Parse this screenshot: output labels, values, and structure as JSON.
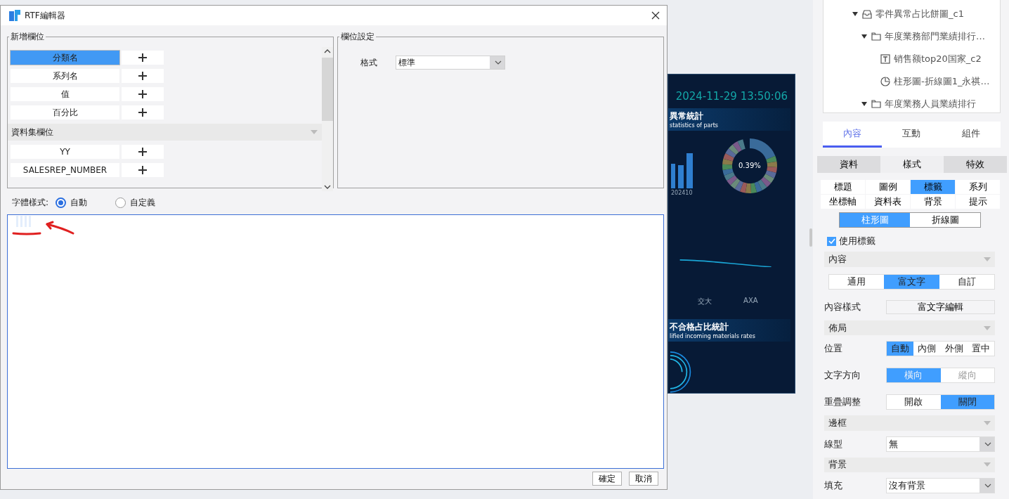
{
  "dialog": {
    "title": "RTF編輯器",
    "add_fields": {
      "legend": "新增欄位",
      "items": [
        {
          "label": "分類名",
          "selected": true
        },
        {
          "label": "系列名",
          "selected": false
        },
        {
          "label": "值",
          "selected": false
        },
        {
          "label": "百分比",
          "selected": false
        }
      ],
      "group": {
        "label": "資料集欄位",
        "items": [
          {
            "label": "YY",
            "selected": false
          },
          {
            "label": "SALESREP_NUMBER",
            "selected": false
          }
        ]
      }
    },
    "field_settings": {
      "legend": "欄位設定",
      "format_label": "格式",
      "format_value": "標準"
    },
    "font_style": {
      "label": "字體樣式:",
      "options": [
        {
          "label": "自動",
          "selected": true
        },
        {
          "label": "自定義",
          "selected": false
        }
      ]
    },
    "buttons": [
      "確定",
      "取消"
    ]
  },
  "preview": {
    "datetime": "2024-11-29 13:50:06",
    "section1_title": "異常統計",
    "section1_subtitle": "statistics of parts",
    "bar_label": "202410",
    "donut_value": "0.39%",
    "x_labels": [
      "交大",
      "AXA"
    ],
    "section2_title": "不合格占比統計",
    "section2_subtitle": "lified incoming materials rates"
  },
  "tree": [
    {
      "label": "零件異常占比餅圖_c1",
      "kind": "tray",
      "expanded": true,
      "selected": false,
      "children": [
        {
          "label": "年度業務部門業績排行…",
          "kind": "folder",
          "expanded": true,
          "selected": false,
          "children": [
            {
              "label": "销售额top20国家_c2",
              "kind": "text",
              "selected": false
            },
            {
              "label": "柱形圖-折線圖1_永祺…",
              "kind": "pie",
              "selected": false
            }
          ]
        },
        {
          "label": "年度業務人員業績排行",
          "kind": "folder",
          "expanded": true,
          "selected": false
        }
      ]
    }
  ],
  "panel_tabs": [
    {
      "label": "內容",
      "selected": true
    },
    {
      "label": "互動",
      "selected": false
    },
    {
      "label": "組件",
      "selected": false
    }
  ],
  "style_tabs": [
    {
      "label": "資料",
      "selected": false
    },
    {
      "label": "樣式",
      "selected": true
    },
    {
      "label": "特效",
      "selected": false
    }
  ],
  "categories": [
    {
      "label": "標題",
      "selected": false
    },
    {
      "label": "圖例",
      "selected": false
    },
    {
      "label": "標籤",
      "selected": true
    },
    {
      "label": "系列",
      "selected": false
    },
    {
      "label": "坐標軸",
      "selected": false
    },
    {
      "label": "資料表",
      "selected": false
    },
    {
      "label": "背景",
      "selected": false
    },
    {
      "label": "提示",
      "selected": false
    }
  ],
  "chart_types": [
    {
      "label": "柱形圖",
      "selected": true
    },
    {
      "label": "折線圖",
      "selected": false
    }
  ],
  "use_label": {
    "label": "使用標籤",
    "checked": true
  },
  "sections": [
    {
      "title": "內容",
      "rows": [
        {
          "kind": "segmented",
          "disabled": false,
          "options": [
            {
              "label": "通用",
              "selected": false
            },
            {
              "label": "富文字",
              "selected": true
            },
            {
              "label": "自訂",
              "selected": false
            }
          ]
        },
        {
          "kind": "button",
          "label": "內容樣式",
          "button": "富文字編輯"
        }
      ]
    },
    {
      "title": "佈局",
      "rows": [
        {
          "kind": "segmented",
          "label": "位置",
          "disabled": false,
          "options": [
            {
              "label": "自動",
              "selected": true
            },
            {
              "label": "內側",
              "selected": false
            },
            {
              "label": "外側",
              "selected": false
            },
            {
              "label": "置中",
              "selected": false
            }
          ]
        },
        {
          "kind": "segmented",
          "label": "文字方向",
          "disabled": true,
          "options": [
            {
              "label": "橫向",
              "selected": true
            },
            {
              "label": "縱向",
              "selected": false
            }
          ]
        },
        {
          "kind": "segmented",
          "label": "重疊調整",
          "disabled": false,
          "options": [
            {
              "label": "開啟",
              "selected": false
            },
            {
              "label": "關閉",
              "selected": true
            }
          ]
        }
      ]
    },
    {
      "title": "邊框",
      "rows": [
        {
          "kind": "select",
          "label": "線型",
          "value": "無"
        }
      ]
    },
    {
      "title": "背景",
      "rows": [
        {
          "kind": "select",
          "label": "填充",
          "value": "沒有背景"
        }
      ]
    }
  ]
}
